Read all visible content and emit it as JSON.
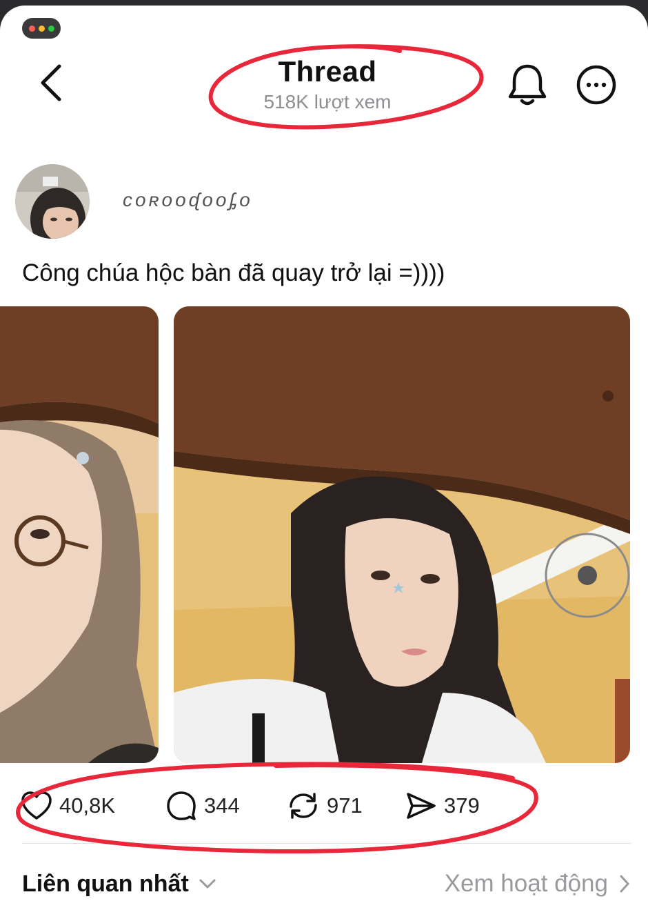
{
  "window": {
    "controls": [
      "#ff5f57",
      "#febc2e",
      "#28c840"
    ]
  },
  "header": {
    "title": "Thread",
    "views": "518K lượt xem",
    "back_icon": "chevron-left-icon",
    "bell_icon": "bell-icon",
    "more_icon": "more-circle-icon"
  },
  "post": {
    "username": "ᴄᴏʀᴏᴏᶑᴏᴏᶋᴏ",
    "text": "Công chúa hộc bàn đã quay trở lại =))))",
    "stats": {
      "likes": "40,8K",
      "comments": "344",
      "reposts": "971",
      "shares": "379"
    }
  },
  "footer": {
    "sort_label": "Liên quan nhất",
    "activity_link": "Xem hoạt động"
  },
  "colors": {
    "annotation": "#e8283a",
    "desk": "#6e3f24",
    "wall": "#e9c37a"
  }
}
